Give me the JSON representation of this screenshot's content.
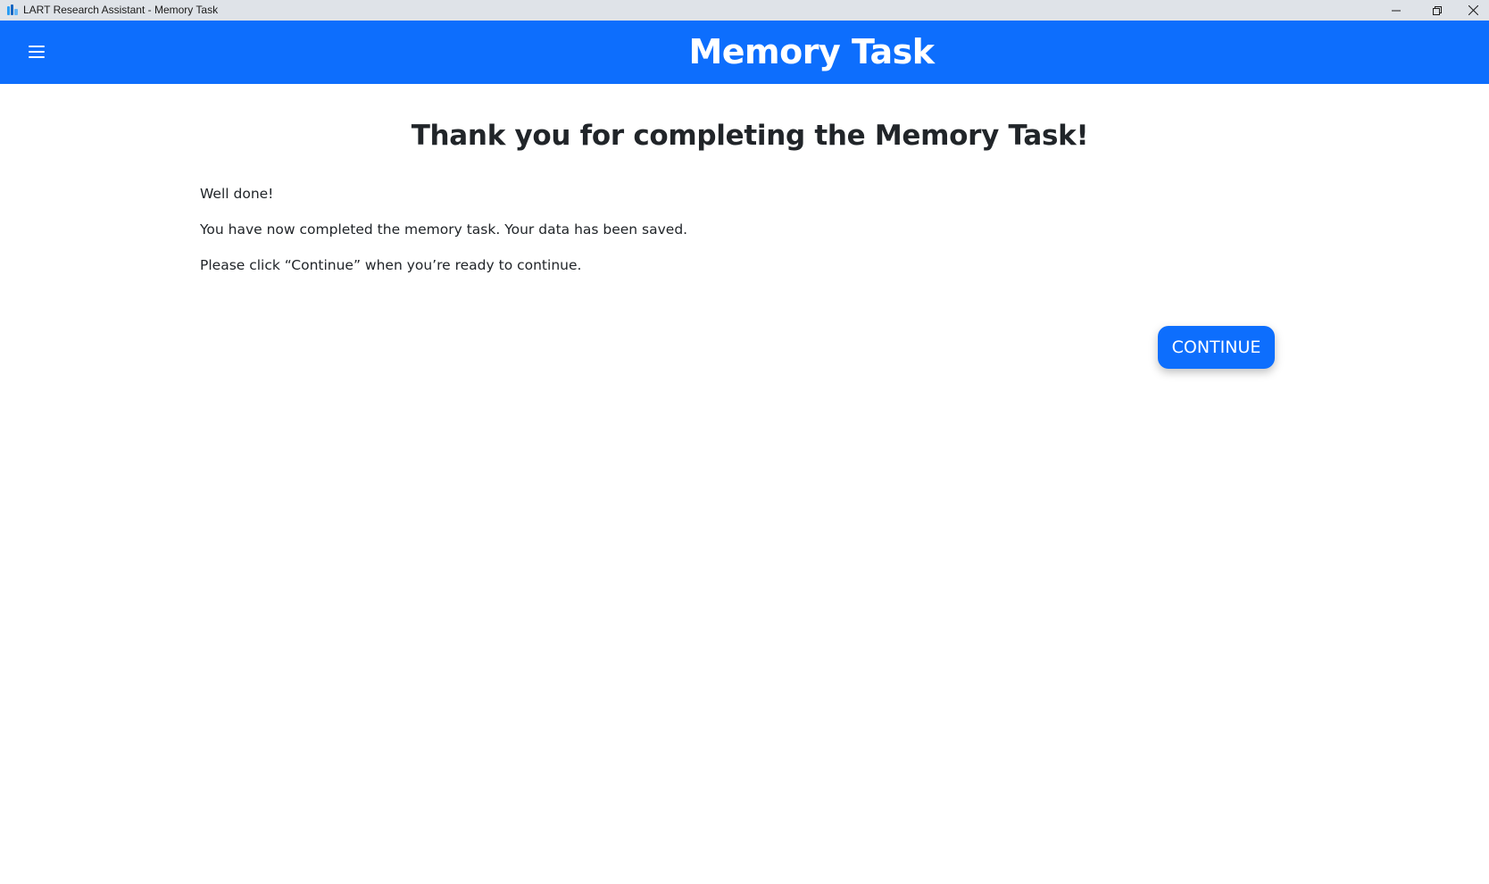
{
  "window": {
    "title": "LART Research Assistant - Memory Task"
  },
  "navbar": {
    "title": "Memory Task",
    "menu_icon": "hamburger-menu-icon"
  },
  "main": {
    "heading": "Thank you for completing the Memory Task!",
    "paragraphs": [
      "Well done!",
      "You have now completed the memory task. Your data has been saved.",
      "Please click “Continue” when you’re ready to continue."
    ],
    "continue_label": "CONTINUE"
  },
  "colors": {
    "primary": "#0d6efd",
    "titlebar": "#dfe3e8",
    "text": "#212529"
  }
}
